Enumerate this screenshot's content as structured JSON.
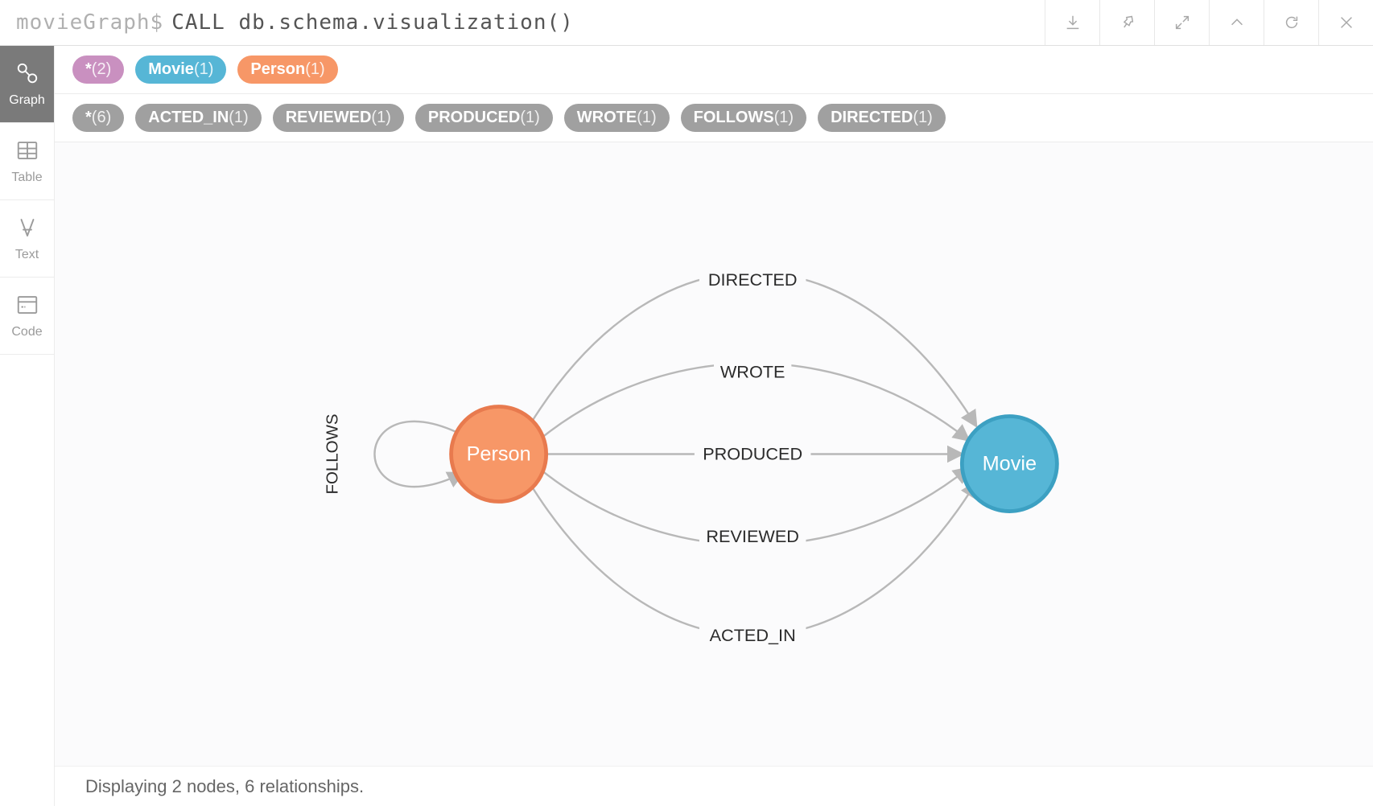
{
  "top": {
    "prompt": "movieGraph$",
    "query": "CALL db.schema.visualization()"
  },
  "sideTabs": [
    {
      "id": "graph",
      "label": "Graph",
      "active": true
    },
    {
      "id": "table",
      "label": "Table",
      "active": false
    },
    {
      "id": "text",
      "label": "Text",
      "active": false
    },
    {
      "id": "code",
      "label": "Code",
      "active": false
    }
  ],
  "nodePills": [
    {
      "label": "*",
      "count": "(2)",
      "color": "purple"
    },
    {
      "label": "Movie",
      "count": "(1)",
      "color": "blue"
    },
    {
      "label": "Person",
      "count": "(1)",
      "color": "orange"
    }
  ],
  "relPills": [
    {
      "label": "*",
      "count": "(6)"
    },
    {
      "label": "ACTED_IN",
      "count": "(1)"
    },
    {
      "label": "REVIEWED",
      "count": "(1)"
    },
    {
      "label": "PRODUCED",
      "count": "(1)"
    },
    {
      "label": "WROTE",
      "count": "(1)"
    },
    {
      "label": "FOLLOWS",
      "count": "(1)"
    },
    {
      "label": "DIRECTED",
      "count": "(1)"
    }
  ],
  "graph": {
    "personLabel": "Person",
    "movieLabel": "Movie",
    "edges": {
      "directed": "DIRECTED",
      "wrote": "WROTE",
      "produced": "PRODUCED",
      "reviewed": "REVIEWED",
      "acted_in": "ACTED_IN",
      "follows": "FOLLOWS"
    }
  },
  "status": "Displaying 2 nodes, 6 relationships."
}
